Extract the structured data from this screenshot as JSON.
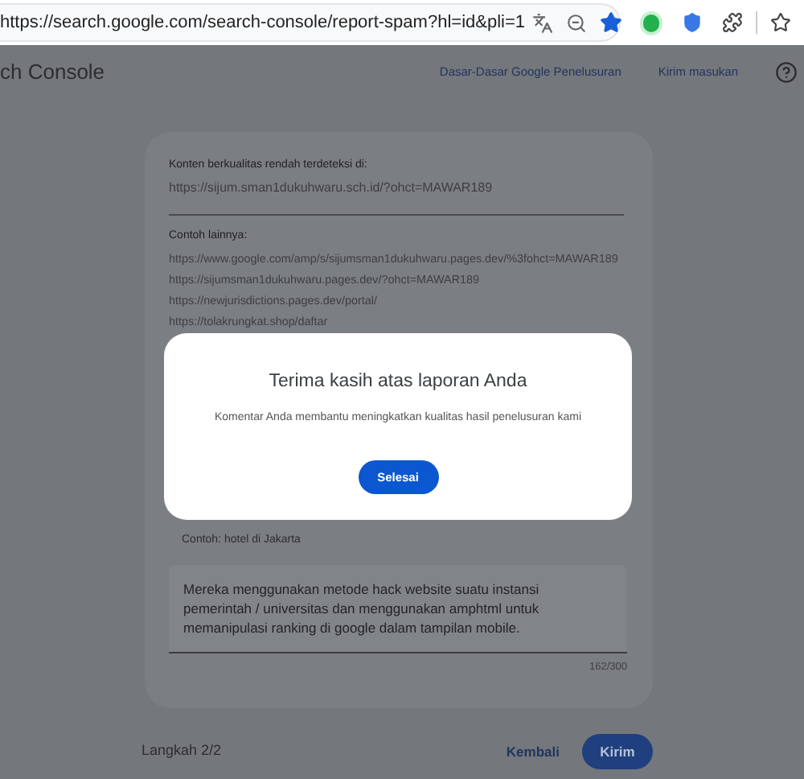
{
  "browser": {
    "url": "https://search.google.com/search-console/report-spam?hl=id&pli=1",
    "bookmarked": true
  },
  "header": {
    "title": "ch Console",
    "links": [
      "Dasar-Dasar Google Penelusuran",
      "Kirim masukan"
    ]
  },
  "report": {
    "detected_label": "Konten berkualitas rendah terdeteksi di:",
    "detected_url": "https://sijum.sman1dukuhwaru.sch.id/?ohct=MAWAR189",
    "examples_label": "Contoh lainnya:",
    "examples": [
      "https://www.google.com/amp/s/sijumsman1dukuhwaru.pages.dev/%3fohct=MAWAR189",
      "https://sijumsman1dukuhwaru.pages.dev/?ohct=MAWAR189",
      "https://newjurisdictions.pages.dev/portal/",
      "https://tolakrungkat.shop/daftar"
    ],
    "query_hint": "Contoh: hotel di Jakarta",
    "comment": {
      "value": "Mereka menggunakan metode hack website suatu instansi pemerintah / universitas dan menggunakan amphtml untuk memanipulasi ranking di google dalam tampilan mobile.",
      "counter": "162/300"
    }
  },
  "footer": {
    "step": "Langkah 2/2",
    "back": "Kembali",
    "submit": "Kirim"
  },
  "dialog": {
    "title": "Terima kasih atas laporan Anda",
    "message": "Komentar Anda membantu meningkatkan kualitas hasil penelusuran kami",
    "button": "Selesai"
  }
}
